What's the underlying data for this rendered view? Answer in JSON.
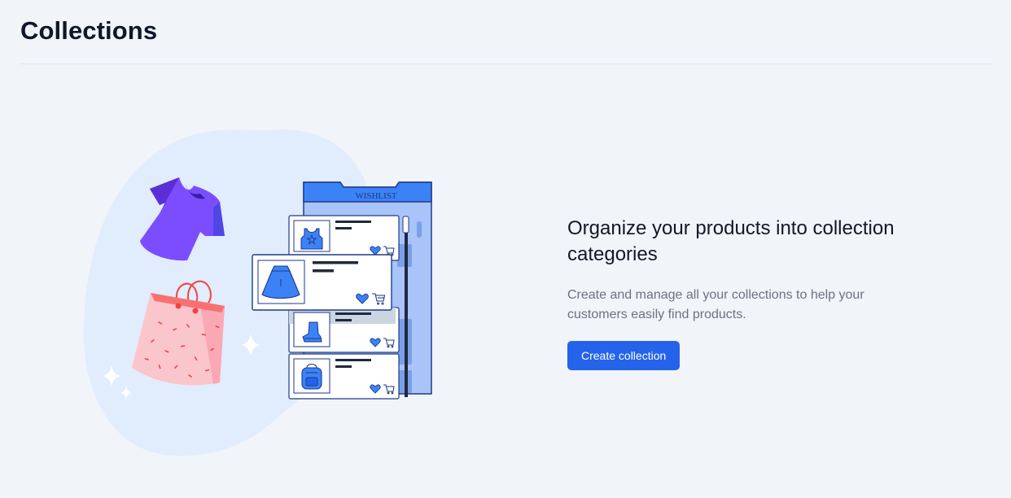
{
  "header": {
    "title": "Collections"
  },
  "empty_state": {
    "heading": "Organize your products into collection categories",
    "description": "Create and manage all your collections to help your customers easily find products.",
    "button_label": "Create collection"
  },
  "illustration": {
    "wishlist_label": "WISHLIST",
    "items": [
      "tank-top-icon",
      "skirt-icon",
      "boot-icon",
      "backpack-icon"
    ],
    "colors": {
      "blob": "#e1ecfd",
      "shirt": "#7c4dff",
      "bag": "#fbbcc5",
      "panel": "#3b82f6",
      "accent": "#2563eb"
    }
  }
}
